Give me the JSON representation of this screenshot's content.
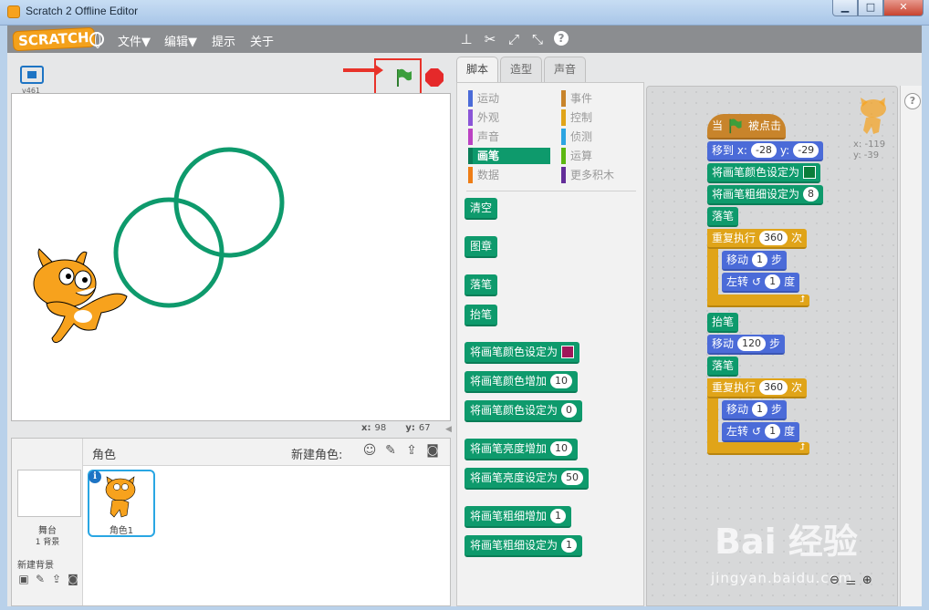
{
  "window": {
    "title": "Scratch 2 Offline Editor",
    "controls": {
      "minimize": "▁",
      "maximize": "□",
      "close": "✕"
    }
  },
  "menubar": {
    "logo": "SCRATCH",
    "items": [
      "文件▼",
      "编辑▼",
      "提示",
      "关于"
    ],
    "tool_icons": [
      "stamp-icon",
      "cut-icon",
      "grow-icon",
      "shrink-icon",
      "help-icon"
    ]
  },
  "stage": {
    "version": "v461",
    "mouse_x_label": "x:",
    "mouse_x": "98",
    "mouse_y_label": "y:",
    "mouse_y": "67"
  },
  "sprites": {
    "header_label": "角色",
    "new_sprite_label": "新建角色:",
    "stage_label": "舞台",
    "stage_backdrops": "1 背景",
    "new_backdrop_label": "新建背景",
    "items": [
      {
        "name": "角色1"
      }
    ]
  },
  "tabs": [
    "脚本",
    "造型",
    "声音"
  ],
  "palette": {
    "categories_left": [
      {
        "label": "运动",
        "color": "#4b6bd8"
      },
      {
        "label": "外观",
        "color": "#8a55d7"
      },
      {
        "label": "声音",
        "color": "#bb42c3"
      },
      {
        "label": "画笔",
        "color": "#0e9a6c"
      },
      {
        "label": "数据",
        "color": "#ee7d16"
      }
    ],
    "categories_right": [
      {
        "label": "事件",
        "color": "#c8842b"
      },
      {
        "label": "控制",
        "color": "#e0a419"
      },
      {
        "label": "侦测",
        "color": "#2ca5e2"
      },
      {
        "label": "运算",
        "color": "#5cb712"
      },
      {
        "label": "更多积木",
        "color": "#632d99"
      }
    ],
    "selected_category": "画笔",
    "blocks": [
      {
        "text": "清空"
      },
      {
        "text": "图章"
      },
      {
        "text": "落笔"
      },
      {
        "text": "抬笔"
      },
      {
        "text": "将画笔颜色设定为",
        "swatch": "#a0185a"
      },
      {
        "text": "将画笔颜色增加",
        "value": "10"
      },
      {
        "text": "将画笔颜色设定为",
        "value": "0"
      },
      {
        "text": "将画笔亮度增加",
        "value": "10"
      },
      {
        "text": "将画笔亮度设定为",
        "value": "50"
      },
      {
        "text": "将画笔粗细增加",
        "value": "1"
      },
      {
        "text": "将画笔粗细设定为",
        "value": "1"
      }
    ]
  },
  "script": {
    "sprite_x": "x: -119",
    "sprite_y": "y: -39",
    "hat": {
      "prefix": "当",
      "suffix": "被点击"
    },
    "goto": {
      "label": "移到 x:",
      "x": "-28",
      "y_label": "y:",
      "y": "-29"
    },
    "set_color": {
      "label": "将画笔颜色设定为",
      "swatch": "#0a7d3a"
    },
    "set_size": {
      "label": "将画笔粗细设定为",
      "value": "8"
    },
    "pen_down_1": "落笔",
    "repeat_1": {
      "label": "重复执行",
      "count": "360",
      "unit": "次"
    },
    "move_1": {
      "label": "移动",
      "value": "1",
      "unit": "步"
    },
    "turn_1": {
      "label": "左转",
      "value": "1",
      "unit": "度"
    },
    "pen_up": "抬笔",
    "move_2": {
      "label": "移动",
      "value": "120",
      "unit": "步"
    },
    "pen_down_2": "落笔",
    "repeat_2": {
      "label": "重复执行",
      "count": "360",
      "unit": "次"
    },
    "move_3": {
      "label": "移动",
      "value": "1",
      "unit": "步"
    },
    "turn_2": {
      "label": "左转",
      "value": "1",
      "unit": "度"
    }
  },
  "watermark": {
    "main": "Bai 经验",
    "sub": "jingyan.baidu.com"
  },
  "colors": {
    "pen_green": "#0e9a6c",
    "motion_blue": "#4b6bd8",
    "control_orange": "#e0a419",
    "highlight_red": "#e8332a"
  }
}
